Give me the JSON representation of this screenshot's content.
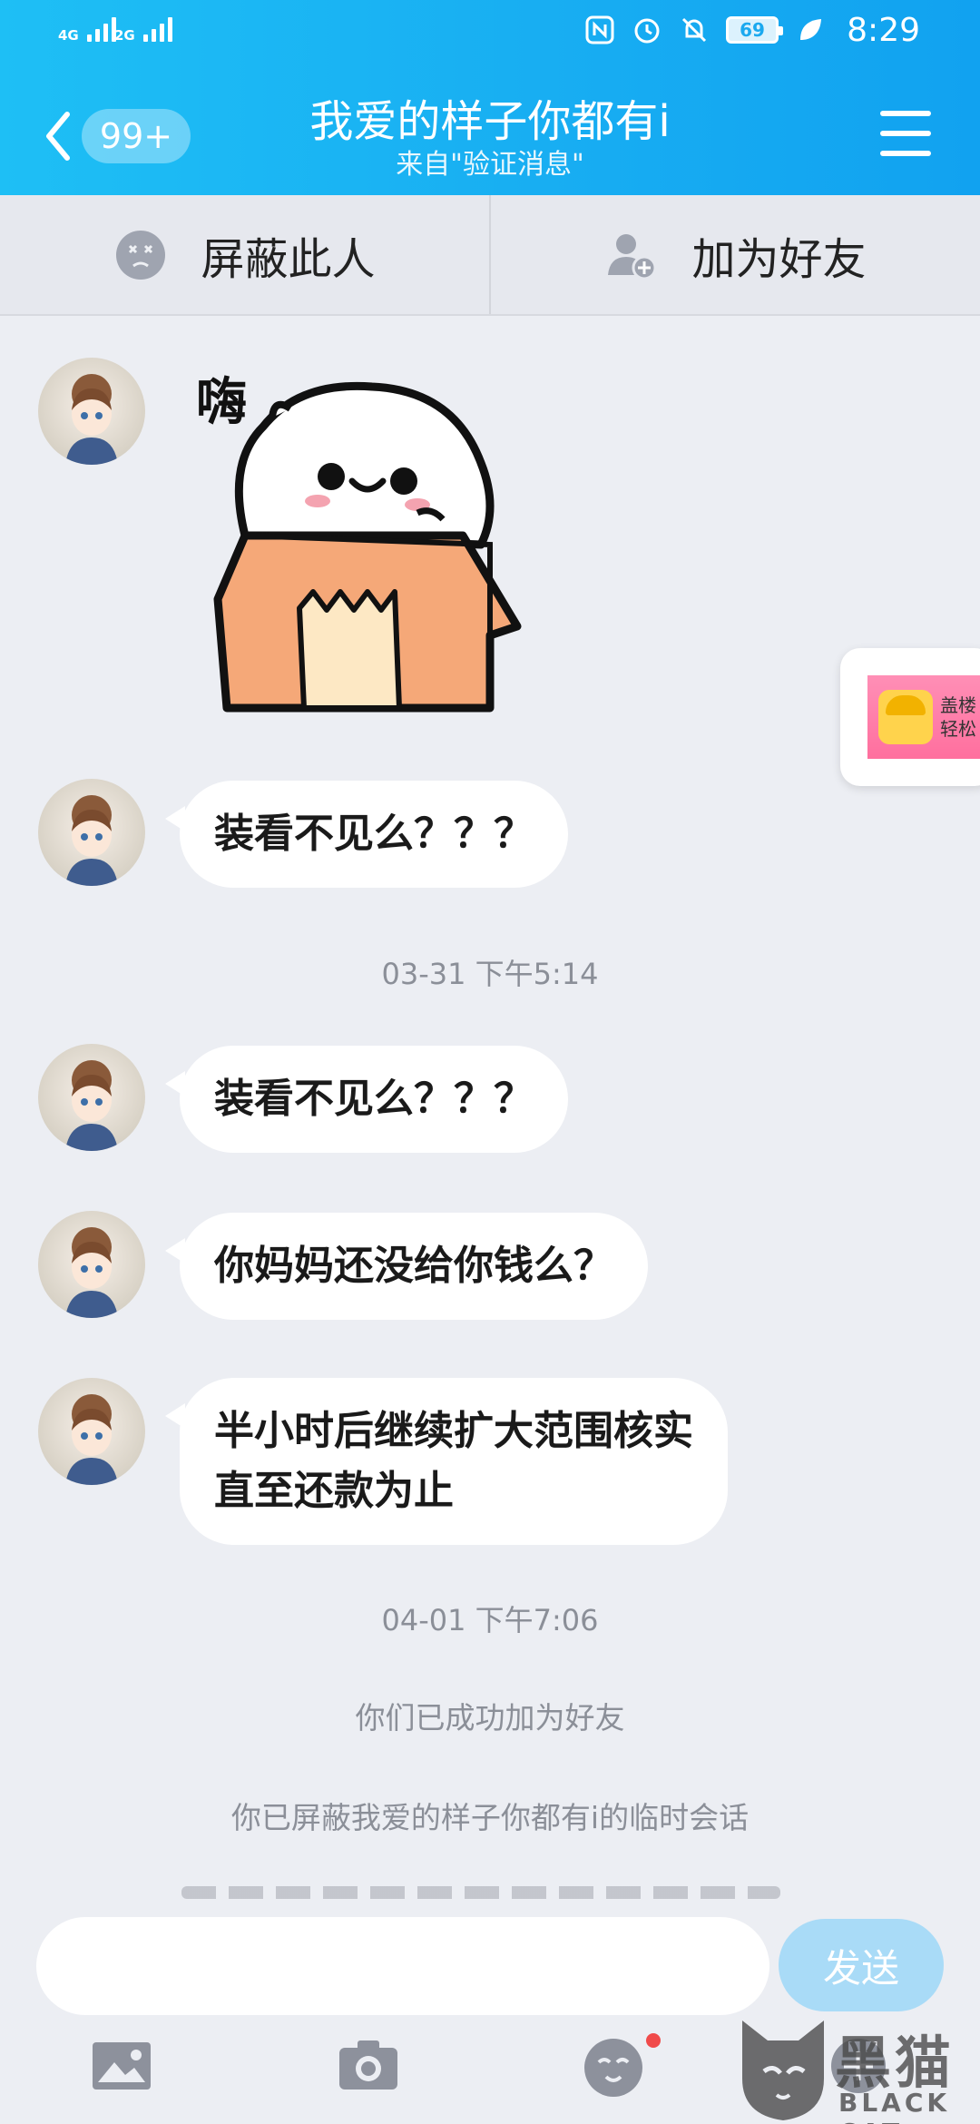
{
  "status_bar": {
    "sim1_label": "4G",
    "sim2_label": "2G",
    "battery": "69",
    "time": "8:29",
    "icons": [
      "nfc-icon",
      "alarm-icon",
      "mute-bell-icon",
      "battery-icon",
      "leaf-icon"
    ]
  },
  "header": {
    "back_badge": "99+",
    "title": "我爱的样子你都有i",
    "subtitle": "来自\"验证消息\""
  },
  "actions": {
    "block": "屏蔽此人",
    "add_friend": "加为好友"
  },
  "messages": [
    {
      "type": "sticker",
      "sticker_text": "嗨"
    },
    {
      "type": "text",
      "text": "装看不见么？？？"
    },
    {
      "type": "timestamp",
      "text": "03-31 下午5:14"
    },
    {
      "type": "text",
      "text": "装看不见么？？？"
    },
    {
      "type": "text",
      "text": "你妈妈还没给你钱么？"
    },
    {
      "type": "text",
      "lines": [
        "半小时后继续扩大范围核实",
        "直至还款为止"
      ]
    },
    {
      "type": "timestamp",
      "text": "04-01 下午7:06"
    },
    {
      "type": "system",
      "text": "你们已成功加为好友"
    },
    {
      "type": "system",
      "text": "你已屏蔽我爱的样子你都有i的临时会话"
    }
  ],
  "ad": {
    "line1": "盖楼",
    "line2": "轻松"
  },
  "input": {
    "value": "",
    "send_label": "发送"
  },
  "toolbar": [
    "image-icon",
    "camera-icon",
    "emoji-icon",
    "more-icon"
  ],
  "watermark": {
    "brand": "黑猫",
    "sub": "BLACK CAT"
  },
  "colors": {
    "header": "#18aef2",
    "send_button": "#a9dbf7",
    "background": "#eceef3"
  }
}
